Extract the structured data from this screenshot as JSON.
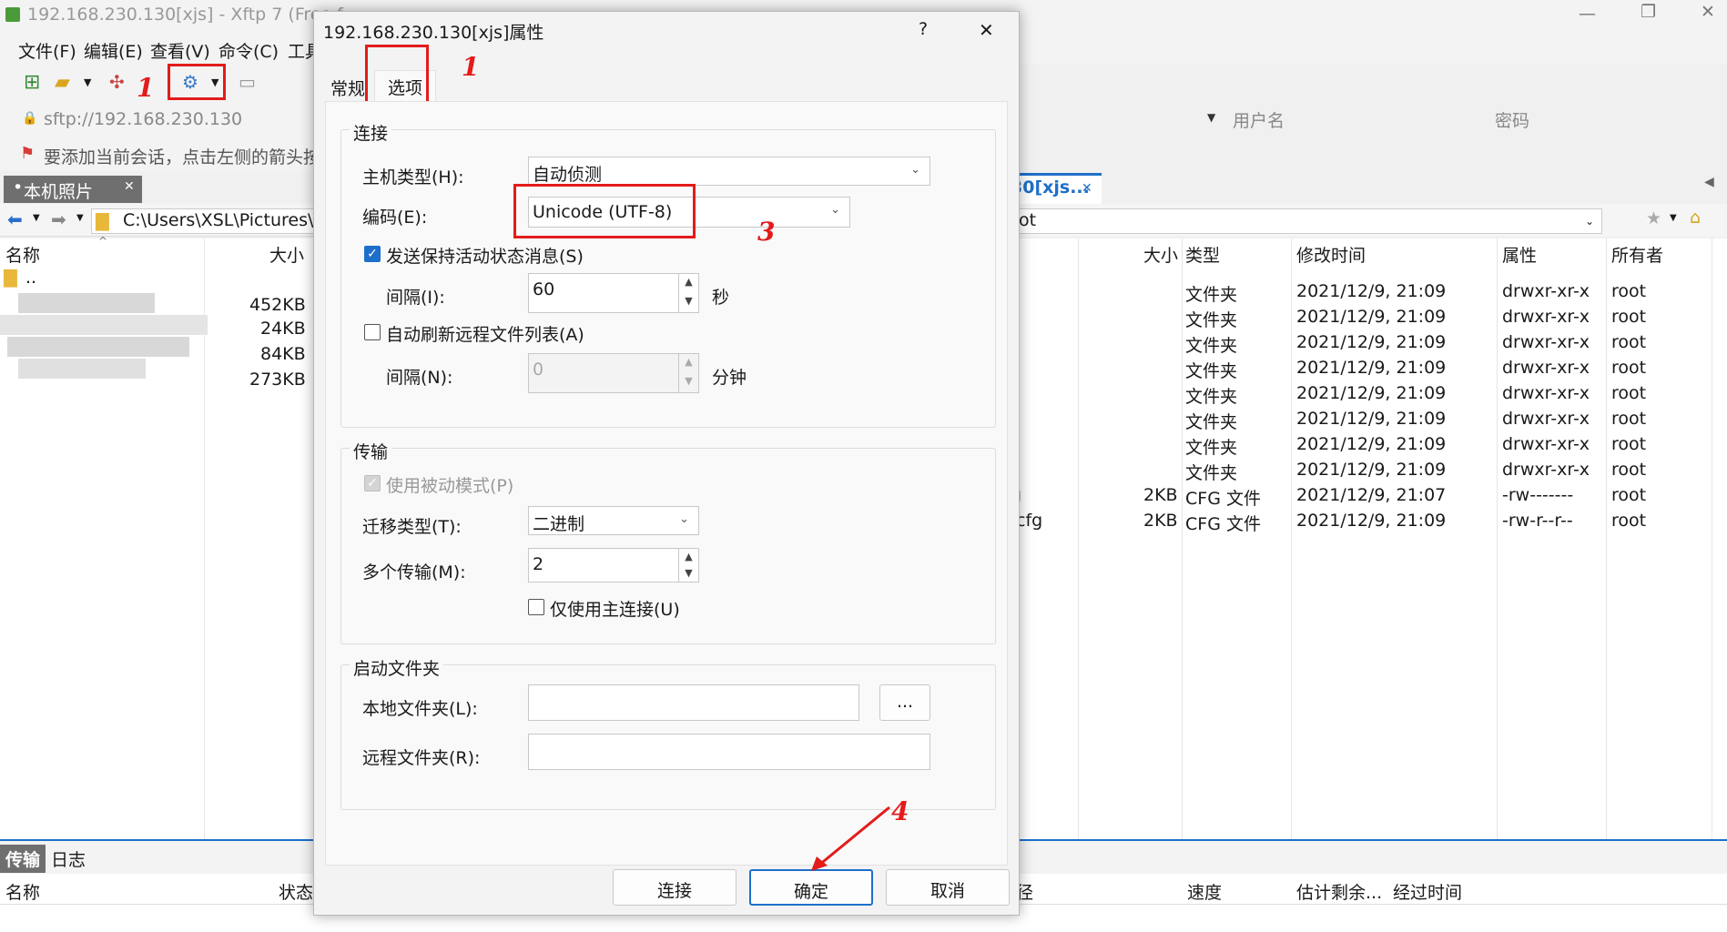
{
  "window": {
    "title": "192.168.230.130[xjs] - Xftp 7 (Free f"
  },
  "menu": [
    "文件(F)",
    "编辑(E)",
    "查看(V)",
    "命令(C)",
    "工具"
  ],
  "address": {
    "value": "sftp://192.168.230.130",
    "username_placeholder": "用户名",
    "password_placeholder": "密码"
  },
  "notice": "要添加当前会话，点击左侧的箭头按钮",
  "left_pane": {
    "tab": "本机照片",
    "path": "C:\\Users\\XSL\\Pictures\\Ca",
    "columns": [
      "名称",
      "大小"
    ],
    "parent": "..",
    "sizes": [
      "452KB",
      "24KB",
      "84KB",
      "273KB"
    ]
  },
  "right_pane": {
    "tab": "30[xjs...",
    "path": "ot",
    "columns": [
      "大小",
      "类型",
      "修改时间",
      "属性",
      "所有者"
    ],
    "rows": [
      {
        "name": "",
        "size": "",
        "type": "文件夹",
        "mtime": "2021/12/9, 21:09",
        "perm": "drwxr-xr-x",
        "owner": "root"
      },
      {
        "name": "",
        "size": "",
        "type": "文件夹",
        "mtime": "2021/12/9, 21:09",
        "perm": "drwxr-xr-x",
        "owner": "root"
      },
      {
        "name": "",
        "size": "",
        "type": "文件夹",
        "mtime": "2021/12/9, 21:09",
        "perm": "drwxr-xr-x",
        "owner": "root"
      },
      {
        "name": "",
        "size": "",
        "type": "文件夹",
        "mtime": "2021/12/9, 21:09",
        "perm": "drwxr-xr-x",
        "owner": "root"
      },
      {
        "name": "",
        "size": "",
        "type": "文件夹",
        "mtime": "2021/12/9, 21:09",
        "perm": "drwxr-xr-x",
        "owner": "root"
      },
      {
        "name": "",
        "size": "",
        "type": "文件夹",
        "mtime": "2021/12/9, 21:09",
        "perm": "drwxr-xr-x",
        "owner": "root"
      },
      {
        "name": "",
        "size": "",
        "type": "文件夹",
        "mtime": "2021/12/9, 21:09",
        "perm": "drwxr-xr-x",
        "owner": "root"
      },
      {
        "name": "",
        "size": "",
        "type": "文件夹",
        "mtime": "2021/12/9, 21:09",
        "perm": "drwxr-xr-x",
        "owner": "root"
      },
      {
        "name": "g",
        "size": "2KB",
        "type": "CFG 文件",
        "mtime": "2021/12/9, 21:07",
        "perm": "-rw-------",
        "owner": "root"
      },
      {
        "name": ".cfg",
        "size": "2KB",
        "type": "CFG 文件",
        "mtime": "2021/12/9, 21:09",
        "perm": "-rw-r--r--",
        "owner": "root"
      }
    ]
  },
  "bottom": {
    "tabs": [
      "传输",
      "日志"
    ],
    "columns": [
      "名称",
      "状态",
      "径",
      "速度",
      "估计剩余...",
      "经过时间"
    ]
  },
  "dialog": {
    "title": "192.168.230.130[xjs]属性",
    "help": "?",
    "close": "✕",
    "tabs": [
      "常规",
      "选项"
    ],
    "connection": {
      "group": "连接",
      "host_type_label": "主机类型(H):",
      "host_type_value": "自动侦测",
      "encoding_label": "编码(E):",
      "encoding_value": "Unicode (UTF-8)",
      "keepalive_label": "发送保持活动状态消息(S)",
      "keepalive_checked": true,
      "interval_label": "间隔(I):",
      "interval_value": "60",
      "interval_unit": "秒",
      "autorefresh_label": "自动刷新远程文件列表(A)",
      "autorefresh_checked": false,
      "interval2_label": "间隔(N):",
      "interval2_value": "0",
      "interval2_unit": "分钟"
    },
    "transfer": {
      "group": "传输",
      "passive_label": "使用被动模式(P)",
      "passive_checked": true,
      "mode_label": "迁移类型(T):",
      "mode_value": "二进制",
      "multi_label": "多个传输(M):",
      "multi_value": "2",
      "main_only_label": "仅使用主连接(U)",
      "main_only_checked": false
    },
    "startup": {
      "group": "启动文件夹",
      "local_label": "本地文件夹(L):",
      "local_value": "",
      "browse_label": "...",
      "remote_label": "远程文件夹(R):",
      "remote_value": ""
    },
    "buttons": {
      "connect": "连接",
      "ok": "确定",
      "cancel": "取消"
    }
  },
  "annotations": {
    "n1a": "1",
    "n1b": "1",
    "n3": "3",
    "n4": "4",
    "color": "#e31b1b"
  }
}
